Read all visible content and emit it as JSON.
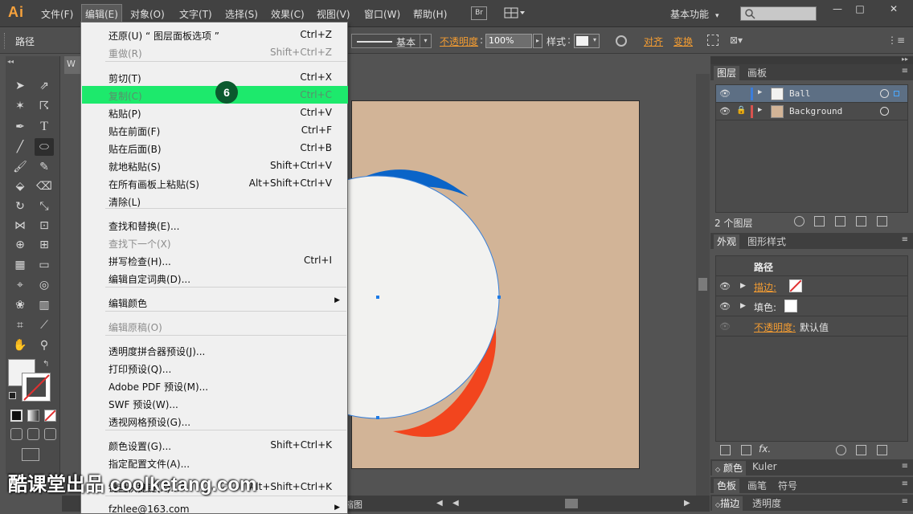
{
  "app": {
    "logo": "Ai",
    "workspace": "基本功能",
    "br_button": "Br",
    "window_buttons": [
      "—",
      "□",
      "✕"
    ]
  },
  "menubar": {
    "items": [
      "文件(F)",
      "编辑(E)",
      "对象(O)",
      "文字(T)",
      "选择(S)",
      "效果(C)",
      "视图(V)",
      "窗口(W)",
      "帮助(H)"
    ],
    "active": "编辑(E)"
  },
  "controlbar": {
    "selection_label": "路径",
    "stroke_style": "基本",
    "opacity_label": "不透明度",
    "opacity_value": "100%",
    "style_label": "样式",
    "align_label": "对齐",
    "transform_label": "变换"
  },
  "document": {
    "tab_label": "W",
    "status_text": "缩图"
  },
  "edit_menu": {
    "items": [
      {
        "label": "还原(U) “ 图层面板选项 ”",
        "shortcut": "Ctrl+Z",
        "disabled": false
      },
      {
        "label": "重做(R)",
        "shortcut": "Shift+Ctrl+Z",
        "disabled": true
      },
      {
        "label": "剪切(T)",
        "shortcut": "Ctrl+X",
        "disabled": false
      },
      {
        "label": "复制(C)",
        "shortcut": "Ctrl+C",
        "disabled": false,
        "highlighted": true
      },
      {
        "label": "粘贴(P)",
        "shortcut": "Ctrl+V",
        "disabled": false
      },
      {
        "label": "贴在前面(F)",
        "shortcut": "Ctrl+F",
        "disabled": false
      },
      {
        "label": "贴在后面(B)",
        "shortcut": "Ctrl+B",
        "disabled": false
      },
      {
        "label": "就地粘贴(S)",
        "shortcut": "Shift+Ctrl+V",
        "disabled": false
      },
      {
        "label": "在所有画板上粘贴(S)",
        "shortcut": "Alt+Shift+Ctrl+V",
        "disabled": false
      },
      {
        "label": "清除(L)",
        "shortcut": "",
        "disabled": false
      },
      {
        "label": "查找和替换(E)...",
        "shortcut": "",
        "disabled": false
      },
      {
        "label": "查找下一个(X)",
        "shortcut": "",
        "disabled": true
      },
      {
        "label": "拼写检查(H)...",
        "shortcut": "Ctrl+I",
        "disabled": false
      },
      {
        "label": "编辑自定词典(D)...",
        "shortcut": "",
        "disabled": false
      },
      {
        "label": "编辑颜色",
        "shortcut": "",
        "disabled": false,
        "submenu": true
      },
      {
        "label": "编辑原稿(O)",
        "shortcut": "",
        "disabled": true
      },
      {
        "label": "透明度拼合器预设(J)...",
        "shortcut": "",
        "disabled": false
      },
      {
        "label": "打印预设(Q)...",
        "shortcut": "",
        "disabled": false
      },
      {
        "label": "Adobe PDF 预设(M)...",
        "shortcut": "",
        "disabled": false
      },
      {
        "label": "SWF 预设(W)...",
        "shortcut": "",
        "disabled": false
      },
      {
        "label": "透视网格预设(G)...",
        "shortcut": "",
        "disabled": false
      },
      {
        "label": "颜色设置(G)...",
        "shortcut": "Shift+Ctrl+K",
        "disabled": false
      },
      {
        "label": "指定配置文件(A)...",
        "shortcut": "",
        "disabled": false
      },
      {
        "label": "键盘快捷键(K)...",
        "shortcut": "Alt+Shift+Ctrl+K",
        "disabled": false
      },
      {
        "label": "fzhlee@163.com",
        "shortcut": "",
        "disabled": false,
        "submenu": true
      }
    ],
    "step_badge": "6"
  },
  "layers_panel": {
    "tabs": [
      "图层",
      "画板"
    ],
    "layers": [
      {
        "name": "Ball",
        "color": "#3c7ddb",
        "selected": true,
        "locked": false
      },
      {
        "name": "Background",
        "color": "#d9534f",
        "selected": false,
        "locked": true
      }
    ],
    "count_label": "2 个图层"
  },
  "appearance_panel": {
    "tabs": [
      "外观",
      "图形样式"
    ],
    "title": "路径",
    "stroke_label": "描边:",
    "fill_label": "填色:",
    "opacity_label": "不透明度:",
    "opacity_value": "默认值",
    "fx_label": "fx."
  },
  "bottom_panels": {
    "color_tabs": [
      "颜色",
      "Kuler"
    ],
    "swatch_tabs": [
      "色板",
      "画笔",
      "符号"
    ],
    "stroke_tabs": [
      "描边",
      "透明度"
    ]
  },
  "watermark": "酷课堂出品 coolketang.com",
  "colors": {
    "accent_orange": "#f39c32",
    "menu_highlight": "#1de96c",
    "artboard": "#d2b497",
    "ball_fill": "#f2f2f0",
    "blue_shape": "#0a64c8",
    "red_shape": "#f2451e"
  }
}
